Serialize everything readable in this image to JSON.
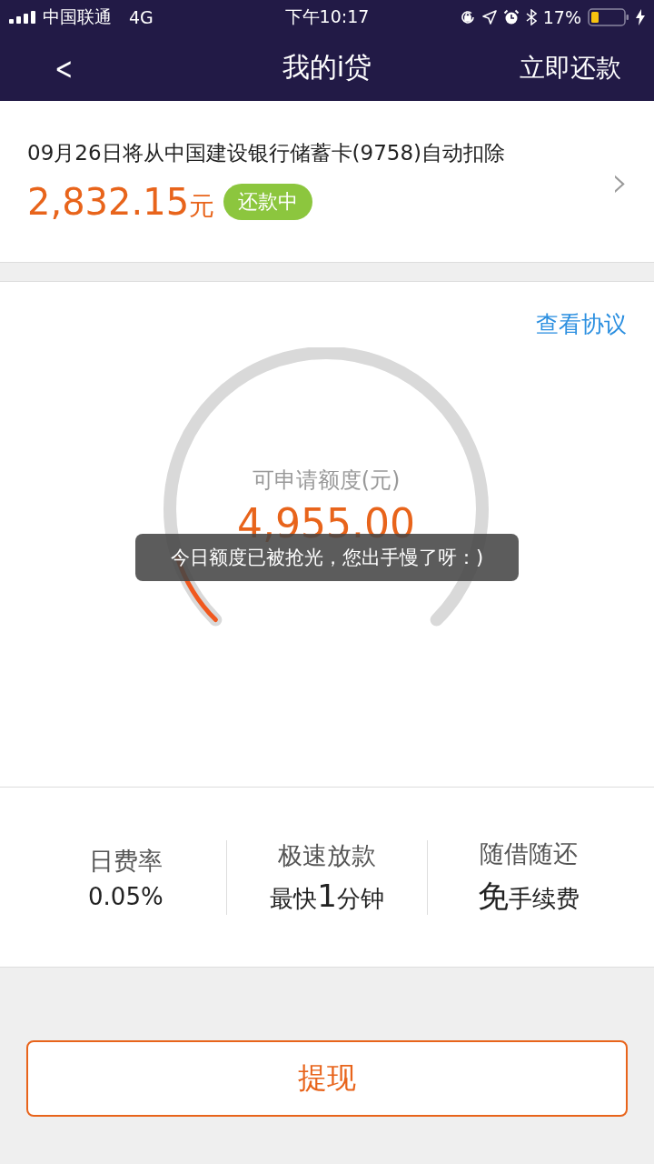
{
  "status_bar": {
    "carrier": "中国联通",
    "network": "4G",
    "time": "下午10:17",
    "battery": "17%"
  },
  "nav": {
    "back": "<",
    "title": "我的i贷",
    "action": "立即还款"
  },
  "repayment": {
    "notice": "09月26日将从中国建设银行储蓄卡(9758)自动扣除",
    "amount": "2,832.15",
    "unit": "元",
    "status": "还款中",
    "chevron": "›"
  },
  "credit": {
    "link": "查看协议",
    "label": "可申请额度(元)",
    "amount": "4,955.00",
    "level": 0.1
  },
  "toast": "今日额度已被抢光，您出手慢了呀：)",
  "features": [
    {
      "title": "日费率",
      "parts": [
        {
          "text": "0.05%",
          "big": false
        }
      ]
    },
    {
      "title": "极速放款",
      "parts": [
        {
          "text": "最快",
          "big": false
        },
        {
          "text": "1",
          "big": true
        },
        {
          "text": "分钟",
          "big": false
        }
      ]
    },
    {
      "title": "随借随还",
      "parts": [
        {
          "text": "免",
          "big": true
        },
        {
          "text": "手续费",
          "big": false
        }
      ]
    }
  ],
  "withdraw_button": "提现"
}
